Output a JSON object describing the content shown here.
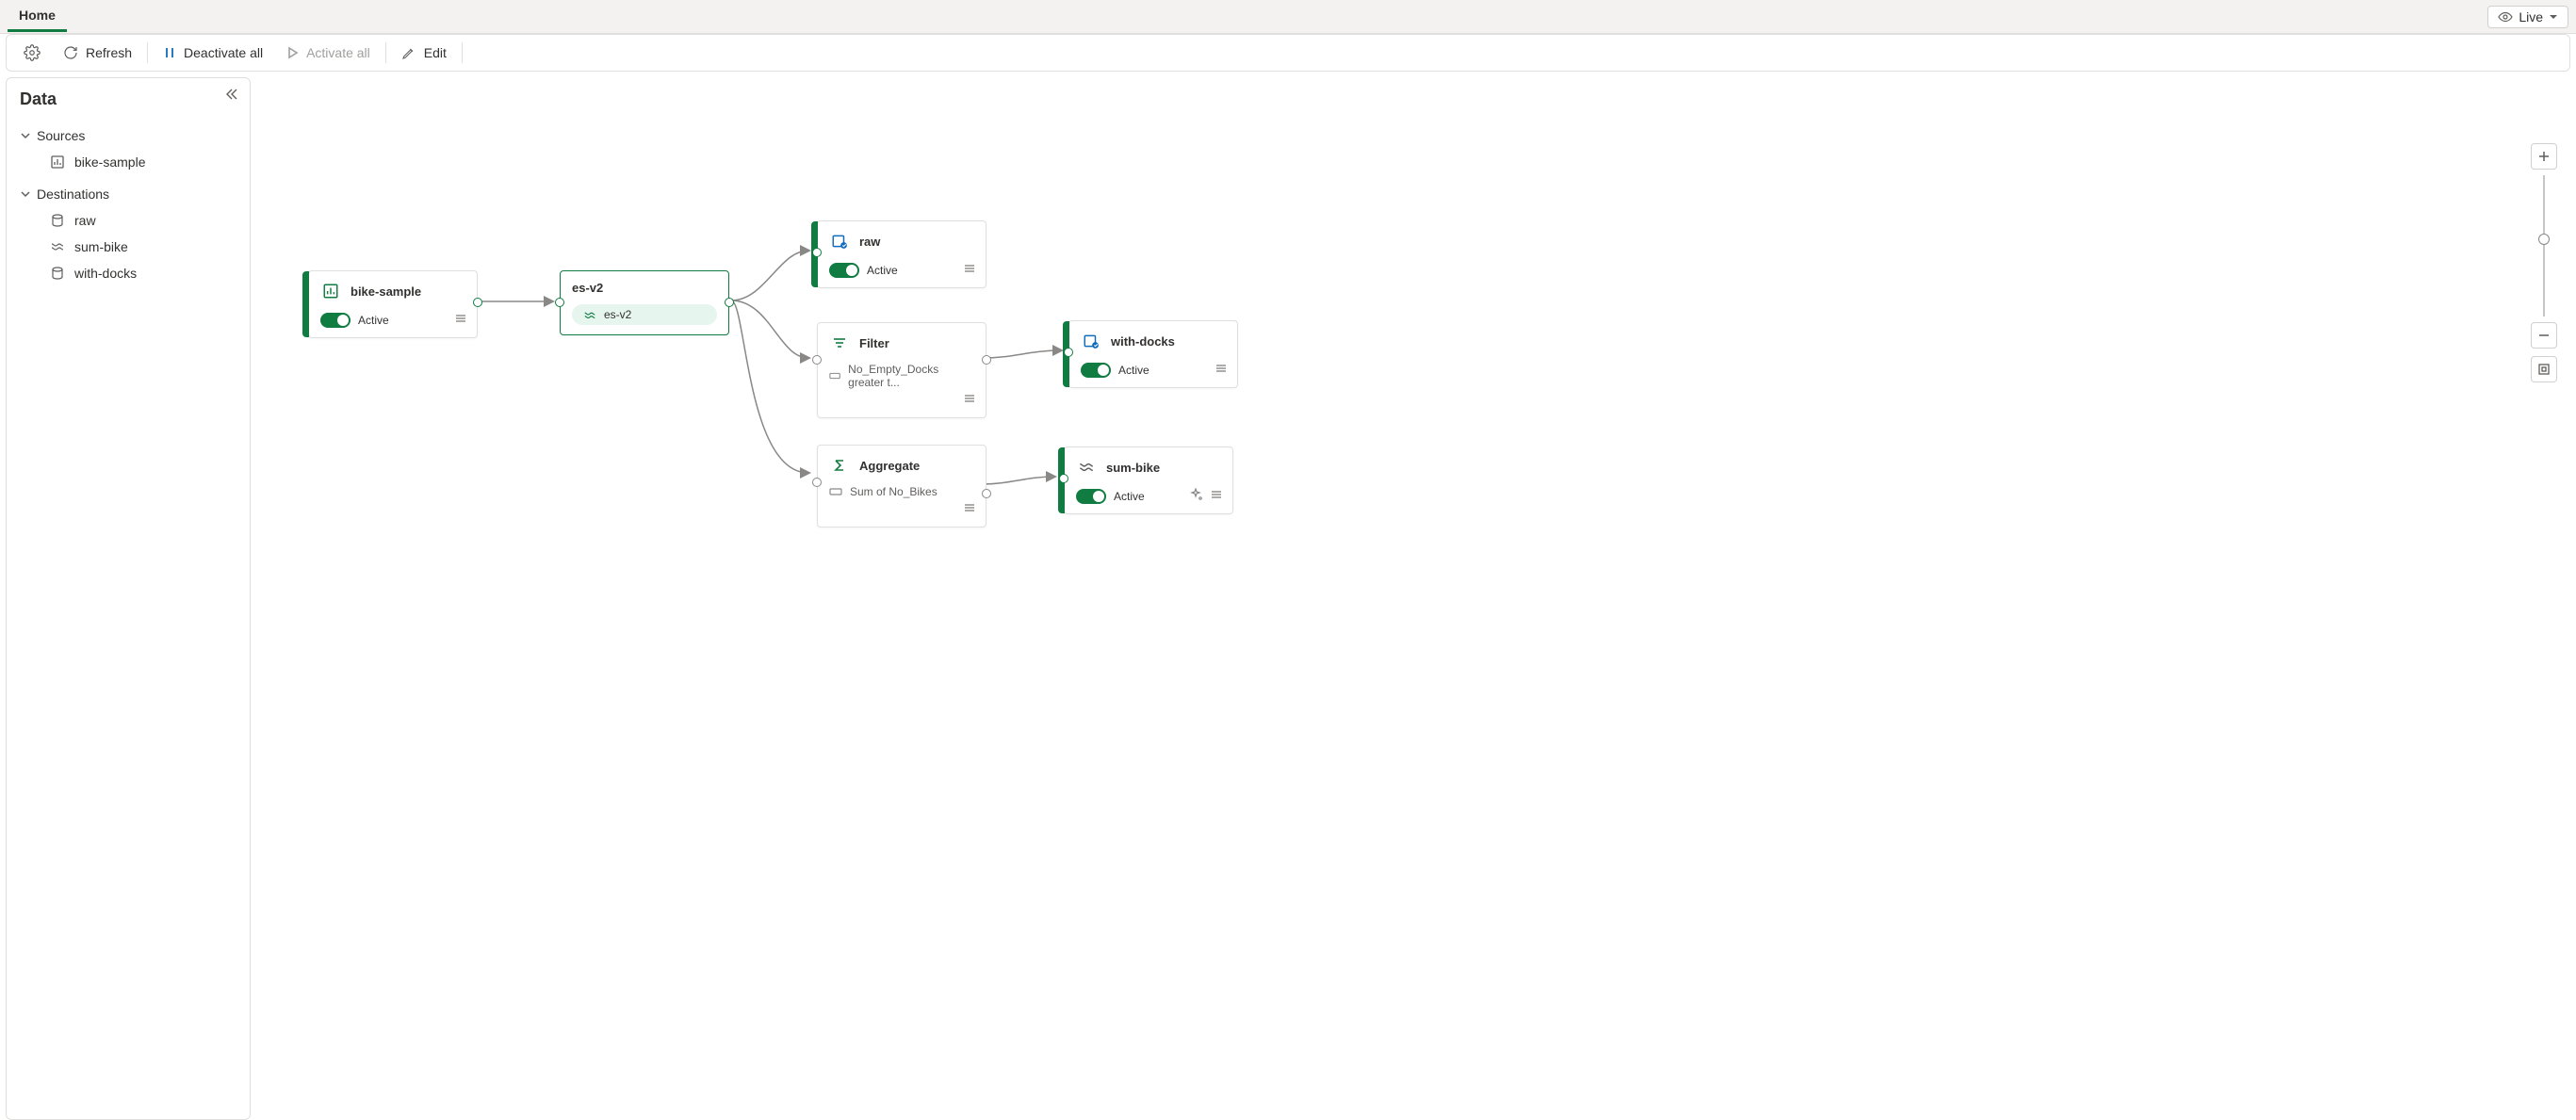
{
  "tabs": {
    "home": "Home"
  },
  "live_button": "Live",
  "toolbar": {
    "refresh": "Refresh",
    "deactivate_all": "Deactivate all",
    "activate_all": "Activate all",
    "edit": "Edit"
  },
  "sidepanel": {
    "title": "Data",
    "sections": {
      "sources": "Sources",
      "destinations": "Destinations"
    },
    "sources": [
      {
        "label": "bike-sample"
      }
    ],
    "destinations": [
      {
        "label": "raw"
      },
      {
        "label": "sum-bike"
      },
      {
        "label": "with-docks"
      }
    ]
  },
  "nodes": {
    "bike_sample": {
      "title": "bike-sample",
      "status": "Active"
    },
    "es_v2": {
      "title": "es-v2",
      "pill": "es-v2"
    },
    "raw": {
      "title": "raw",
      "status": "Active"
    },
    "filter": {
      "title": "Filter",
      "rule": "No_Empty_Docks greater t..."
    },
    "aggregate": {
      "title": "Aggregate",
      "rule": "Sum of No_Bikes"
    },
    "with_docks": {
      "title": "with-docks",
      "status": "Active"
    },
    "sum_bike": {
      "title": "sum-bike",
      "status": "Active"
    }
  }
}
